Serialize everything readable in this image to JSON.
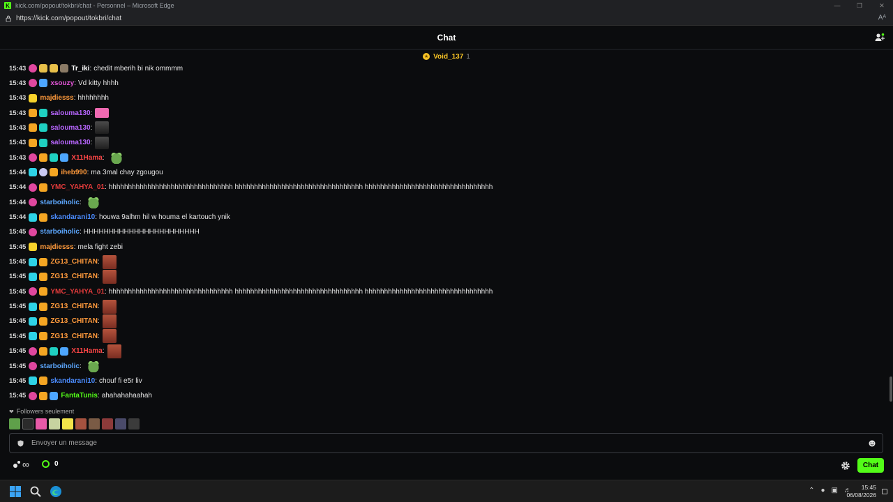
{
  "window": {
    "title": "kick.com/popout/tokbri/chat - Personnel – Microsoft Edge",
    "url": "https://kick.com/popout/tokbri/chat",
    "reader_glyph": "Aᴬ"
  },
  "chat": {
    "header_title": "Chat",
    "pinned": {
      "name": "Void_137",
      "count": "1"
    },
    "messages": [
      {
        "time": "15:43",
        "user": "Tr_iki",
        "color": "#ffffff",
        "text": "chedit mberih bi nik ommmm"
      },
      {
        "time": "15:43",
        "user": "xsouzy",
        "color": "#e255d6",
        "text": "Vd kitty hhhh"
      },
      {
        "time": "15:43",
        "user": "majdiesss",
        "color": "#ff9a3c",
        "text": "hhhhhhhh"
      },
      {
        "time": "15:43",
        "user": "salouma130",
        "color": "#b866ff",
        "text": ""
      },
      {
        "time": "15:43",
        "user": "salouma130",
        "color": "#b866ff",
        "text": ""
      },
      {
        "time": "15:43",
        "user": "salouma130",
        "color": "#b866ff",
        "text": ""
      },
      {
        "time": "15:43",
        "user": "X11Hama",
        "color": "#ff4646",
        "text": ""
      },
      {
        "time": "15:44",
        "user": "iheb990",
        "color": "#ff9a3c",
        "text": "ma 3mal chay zgougou"
      },
      {
        "time": "15:44",
        "user": "YMC_YAHYA_01",
        "color": "#e23b3b",
        "text": "hhhhhhhhhhhhhhhhhhhhhhhhhhhhhhhh hhhhhhhhhhhhhhhhhhhhhhhhhhhhhhhhh hhhhhhhhhhhhhhhhhhhhhhhhhhhhhhhhh"
      },
      {
        "time": "15:44",
        "user": "starboiholic",
        "color": "#5da8ff",
        "text": ""
      },
      {
        "time": "15:44",
        "user": "skandarani10",
        "color": "#4b8cff",
        "text": "houwa 9alhm hil w houma el kartouch ynik"
      },
      {
        "time": "15:45",
        "user": "starboiholic",
        "color": "#5da8ff",
        "text": "HHHHHHHHHHHHHHHHHHHHHHH"
      },
      {
        "time": "15:45",
        "user": "majdiesss",
        "color": "#ff9a3c",
        "text": "mela fight zebi"
      },
      {
        "time": "15:45",
        "user": "ZG13_CHITAN",
        "color": "#ff9a3c",
        "text": ""
      },
      {
        "time": "15:45",
        "user": "ZG13_CHITAN",
        "color": "#ff9a3c",
        "text": ""
      },
      {
        "time": "15:45",
        "user": "YMC_YAHYA_01",
        "color": "#e23b3b",
        "text": "hhhhhhhhhhhhhhhhhhhhhhhhhhhhhhhh hhhhhhhhhhhhhhhhhhhhhhhhhhhhhhhhh hhhhhhhhhhhhhhhhhhhhhhhhhhhhhhhhh"
      },
      {
        "time": "15:45",
        "user": "ZG13_CHITAN",
        "color": "#ff9a3c",
        "text": ""
      },
      {
        "time": "15:45",
        "user": "ZG13_CHITAN",
        "color": "#ff9a3c",
        "text": ""
      },
      {
        "time": "15:45",
        "user": "ZG13_CHITAN",
        "color": "#ff9a3c",
        "text": ""
      },
      {
        "time": "15:45",
        "user": "X11Hama",
        "color": "#ff4646",
        "text": ""
      },
      {
        "time": "15:45",
        "user": "starboiholic",
        "color": "#5da8ff",
        "text": ""
      },
      {
        "time": "15:45",
        "user": "skandarani10",
        "color": "#4b8cff",
        "text": "chouf fi e5r liv"
      },
      {
        "time": "15:45",
        "user": "FantaTunis",
        "color": "#53fc18",
        "text": "ahahahahaahah"
      }
    ],
    "followers_label": "Followers seulement",
    "input_placeholder": "Envoyer un message",
    "points_label": "∞",
    "coin_count": "0",
    "chat_button": "Chat"
  },
  "taskbar": {
    "time": "15:45",
    "date": "06/08/2026"
  },
  "colors": {
    "accent": "#53fc18",
    "background": "#0b0c0e"
  }
}
